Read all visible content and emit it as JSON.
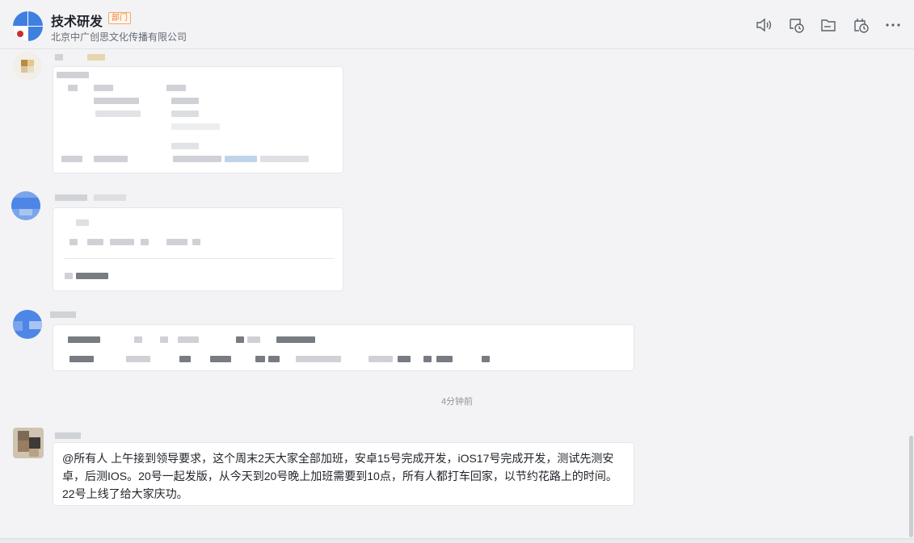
{
  "header": {
    "title": "技术研发",
    "badge": "部门",
    "subtitle": "北京中广创思文化传播有限公司",
    "icons": [
      "speaker-icon",
      "history-chat-icon",
      "folder-icon",
      "calendar-clock-icon",
      "more-icon"
    ]
  },
  "divider": {
    "time": "4分钟前"
  },
  "last_message": {
    "text": "@所有人  上午接到领导要求，这个周末2天大家全部加班，安卓15号完成开发，iOS17号完成开发，测试先测安卓，后测IOS。20号一起发版，从今天到20号晚上加班需要到10点，所有人都打车回家，以节约花路上的时间。22号上线了给大家庆功。"
  },
  "colors": {
    "accent": "#3f7fe0",
    "badge": "#e8843a",
    "background": "#f3f3f5"
  }
}
